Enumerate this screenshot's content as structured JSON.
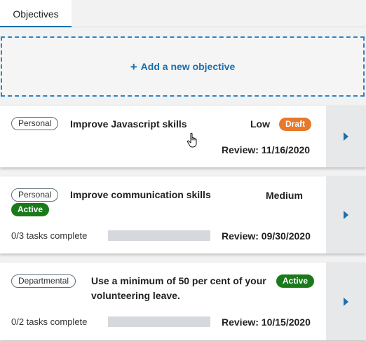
{
  "tabs": [
    {
      "label": "Objectives"
    }
  ],
  "add_objective": {
    "icon": "plus-icon",
    "plus": "+",
    "label": "Add a new objective"
  },
  "objectives": [
    {
      "category": "Personal",
      "title": "Improve Javascript skills",
      "priority": "Low",
      "status": "Draft",
      "review": "Review: 11/16/2020"
    },
    {
      "category": "Personal",
      "title": "Improve communication skills",
      "priority": "Medium",
      "status": "Active",
      "tasks": "0/3 tasks complete",
      "progress": 0,
      "review": "Review: 09/30/2020"
    },
    {
      "category": "Departmental",
      "title": "Use a minimum of 50 per cent of your volunteering leave.",
      "status": "Active",
      "tasks": "0/2 tasks complete",
      "progress": 0,
      "review": "Review: 10/15/2020"
    }
  ],
  "colors": {
    "accent": "#1a6fb0",
    "draft": "#e8782a",
    "active": "#1a7a1a"
  }
}
